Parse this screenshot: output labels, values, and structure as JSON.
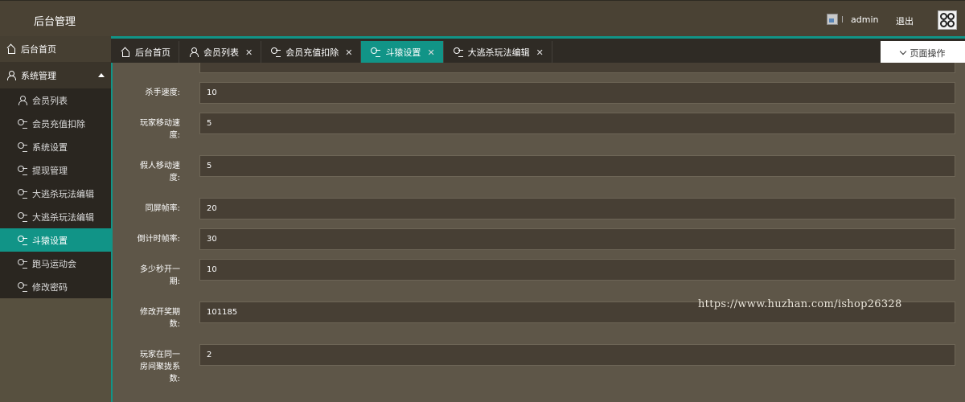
{
  "header": {
    "app_title": "后台管理",
    "username": "admin",
    "logout_label": "退出"
  },
  "sidebar": {
    "home_label": "后台首页",
    "group_label": "系统管理",
    "items": [
      {
        "label": "会员列表",
        "icon": "user-icon"
      },
      {
        "label": "会员充值扣除",
        "icon": "settings-icon"
      },
      {
        "label": "系统设置",
        "icon": "settings-icon"
      },
      {
        "label": "提现管理",
        "icon": "settings-icon"
      },
      {
        "label": "大逃杀玩法编辑",
        "icon": "settings-icon"
      },
      {
        "label": "大逃杀玩法编辑",
        "icon": "settings-icon"
      },
      {
        "label": "斗猿设置",
        "icon": "settings-icon",
        "active": true
      },
      {
        "label": "跑马运动会",
        "icon": "settings-icon"
      },
      {
        "label": "修改密码",
        "icon": "settings-icon"
      }
    ]
  },
  "tabs": [
    {
      "label": "后台首页",
      "icon": "home-icon",
      "closable": false
    },
    {
      "label": "会员列表",
      "icon": "user-icon",
      "closable": true
    },
    {
      "label": "会员充值扣除",
      "icon": "settings-icon",
      "closable": true
    },
    {
      "label": "斗猿设置",
      "icon": "settings-icon",
      "closable": true,
      "active": true
    },
    {
      "label": "大逃杀玩法编辑",
      "icon": "settings-icon",
      "closable": true
    }
  ],
  "page_ops_label": "页面操作",
  "form": {
    "fields": [
      {
        "label": "杀手速度:",
        "value": "10"
      },
      {
        "label": "玩家移动速度:",
        "value": "5"
      },
      {
        "label": "假人移动速度:",
        "value": "5"
      },
      {
        "label": "同屏帧率:",
        "value": "20"
      },
      {
        "label": "倒计时帧率:",
        "value": "30"
      },
      {
        "label": "多少秒开一期:",
        "value": "10"
      },
      {
        "label": "修改开奖期数:",
        "value": "101185"
      },
      {
        "label": "玩家在同一房间聚拢系数:",
        "value": "2"
      }
    ]
  },
  "watermark": "https://www.huzhan.com/ishop26328",
  "colors": {
    "accent": "#119487",
    "header_bg": "#4a4234",
    "content_bg": "#5e5648"
  }
}
